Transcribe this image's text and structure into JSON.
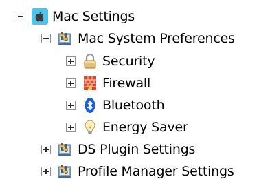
{
  "tree": {
    "root": {
      "label": "Mac Settings",
      "icon": "apple-icon",
      "expanded": true
    },
    "system_preferences": {
      "label": "Mac System Preferences",
      "icon": "preferences-icon",
      "expanded": true
    },
    "children": [
      {
        "label": "Security",
        "icon": "lock-icon",
        "expanded": false
      },
      {
        "label": "Firewall",
        "icon": "firewall-icon",
        "expanded": false
      },
      {
        "label": "Bluetooth",
        "icon": "bluetooth-icon",
        "expanded": false
      },
      {
        "label": "Energy Saver",
        "icon": "lightbulb-icon",
        "expanded": false
      }
    ],
    "ds_plugin": {
      "label": "DS Plugin Settings",
      "icon": "preferences-icon",
      "expanded": false
    },
    "profile_manager": {
      "label": "Profile Manager Settings",
      "icon": "preferences-icon",
      "expanded": false
    }
  },
  "colors": {
    "expander_border": "#919191",
    "bluetooth": "#1a5fd6",
    "firewall": "#d94a2a",
    "lock": "#c9a05a",
    "apple_bg": "#4fc3e8"
  }
}
